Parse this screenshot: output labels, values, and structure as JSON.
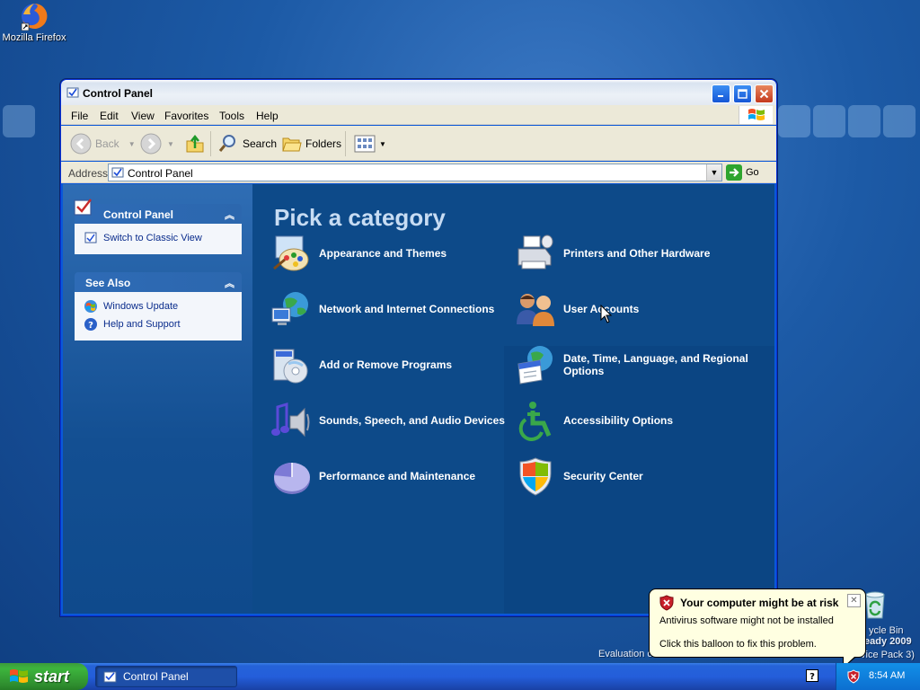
{
  "desktop": {
    "icons": [
      {
        "label": "Mozilla Firefox"
      }
    ],
    "recycle_bin_label": "ycle Bin",
    "watermark_line1": "eady 2009",
    "watermark_line2": "vice Pack 3)",
    "evaluation_text": "Evaluation c"
  },
  "window": {
    "title": "Control Panel",
    "menu": [
      "File",
      "Edit",
      "View",
      "Favorites",
      "Tools",
      "Help"
    ],
    "toolbar": {
      "back": "Back",
      "search": "Search",
      "folders": "Folders"
    },
    "address": {
      "label": "Address",
      "value": "Control Panel",
      "go": "Go"
    }
  },
  "sidebar": {
    "panels": [
      {
        "title": "Control Panel",
        "links": [
          {
            "label": "Switch to Classic View",
            "icon": "switch-view-icon"
          }
        ]
      },
      {
        "title": "See Also",
        "links": [
          {
            "label": "Windows Update",
            "icon": "windows-update-icon"
          },
          {
            "label": "Help and Support",
            "icon": "help-icon"
          }
        ]
      }
    ]
  },
  "main": {
    "heading": "Pick a category",
    "categories": [
      {
        "label": "Appearance and Themes",
        "icon": "appearance-icon"
      },
      {
        "label": "Printers and Other Hardware",
        "icon": "printer-icon"
      },
      {
        "label": "Network and Internet Connections",
        "icon": "network-icon"
      },
      {
        "label": "User Accounts",
        "icon": "users-icon"
      },
      {
        "label": "Add or Remove Programs",
        "icon": "add-remove-icon"
      },
      {
        "label": "Date, Time, Language, and Regional Options",
        "icon": "datetime-icon"
      },
      {
        "label": "Sounds, Speech, and Audio Devices",
        "icon": "sound-icon"
      },
      {
        "label": "Accessibility Options",
        "icon": "accessibility-icon"
      },
      {
        "label": "Performance and Maintenance",
        "icon": "performance-icon"
      },
      {
        "label": "Security Center",
        "icon": "security-shield-icon"
      }
    ]
  },
  "balloon": {
    "title": "Your computer might be at risk",
    "line1": "Antivirus software might not be installed",
    "line2": "Click this balloon to fix this problem."
  },
  "taskbar": {
    "start": "start",
    "task": "Control Panel",
    "clock": "8:54 AM"
  }
}
